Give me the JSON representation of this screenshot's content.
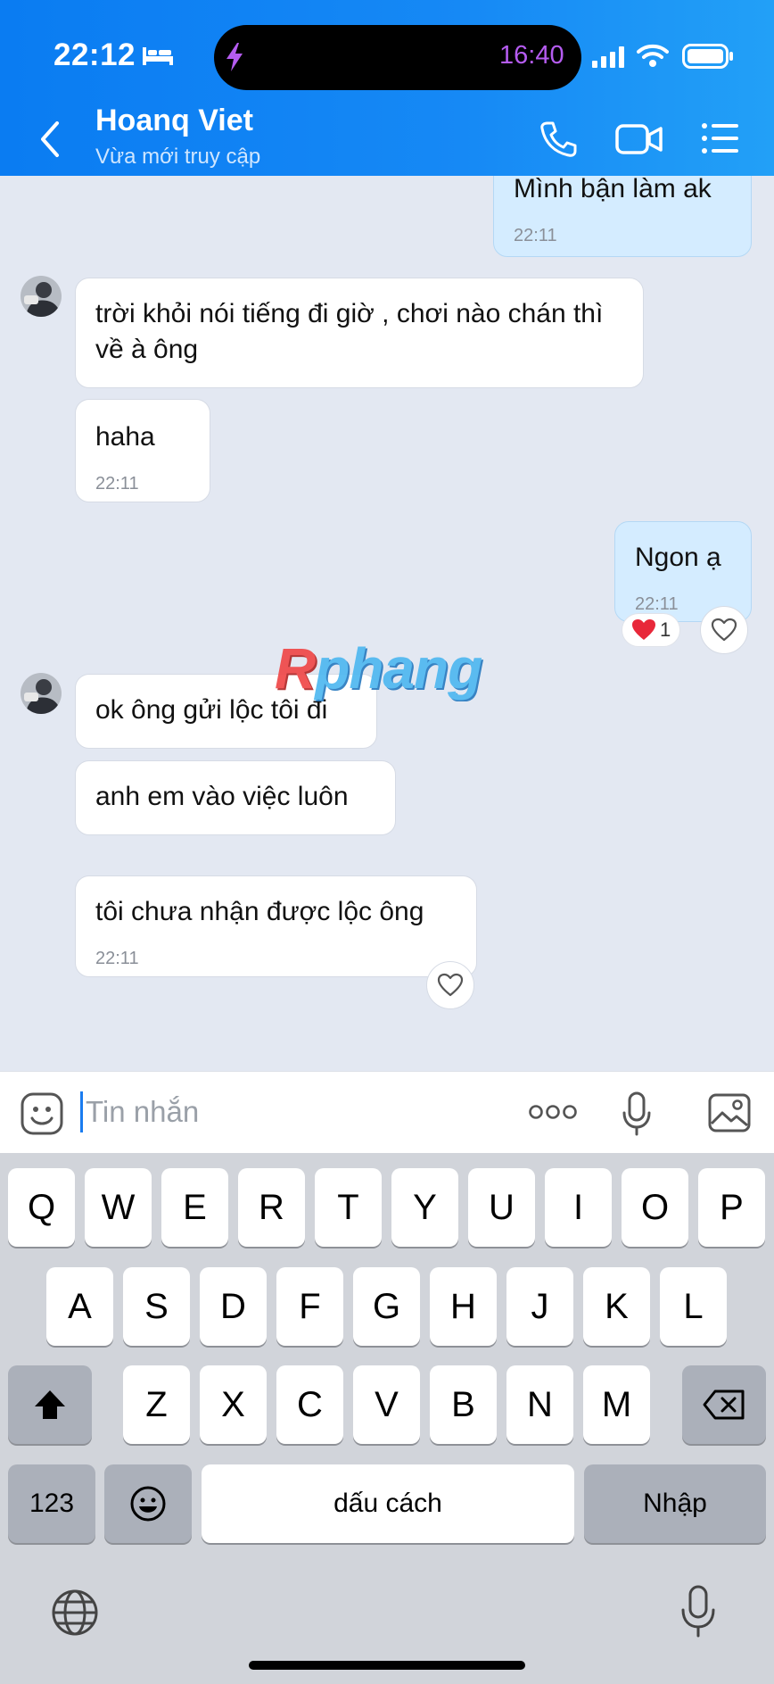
{
  "status_bar": {
    "time": "22:12",
    "activity_time": "16:40",
    "icons": [
      "bed-icon",
      "bolt-icon",
      "signal-icon",
      "wifi-icon",
      "battery-icon"
    ]
  },
  "header": {
    "contact_name": "Hoanq Viet",
    "contact_status": "Vừa mới truy cập",
    "icons": [
      "back-icon",
      "call-icon",
      "video-call-icon",
      "menu-icon"
    ],
    "accent_color": "#1689f5"
  },
  "messages": [
    {
      "side": "out",
      "text": "Mình bận làm ak",
      "time": "22:11"
    },
    {
      "side": "in",
      "text": "trời khỏi nói tiếng đi giờ , chơi nào chán thì về à ông",
      "time": ""
    },
    {
      "side": "in",
      "text": "haha",
      "time": "22:11"
    },
    {
      "side": "out",
      "text": "Ngon ạ",
      "time": "22:11",
      "reaction_count": "1"
    },
    {
      "side": "in",
      "text": "ok ông gửi lộc tôi đi",
      "time": ""
    },
    {
      "side": "in",
      "text": "anh em vào việc luôn",
      "time": ""
    },
    {
      "side": "in",
      "text": "tôi chưa nhận được lộc ông",
      "time": "22:11"
    }
  ],
  "watermark": {
    "first": "R",
    "rest": "phang"
  },
  "composer": {
    "placeholder": "Tin nhắn",
    "icons": [
      "sticker-icon",
      "more-icon",
      "mic-icon",
      "image-icon"
    ]
  },
  "keyboard": {
    "row1": [
      "Q",
      "W",
      "E",
      "R",
      "T",
      "Y",
      "U",
      "I",
      "O",
      "P"
    ],
    "row2": [
      "A",
      "S",
      "D",
      "F",
      "G",
      "H",
      "J",
      "K",
      "L"
    ],
    "row3": [
      "Z",
      "X",
      "C",
      "V",
      "B",
      "N",
      "M"
    ],
    "numbers_label": "123",
    "space_label": "dấu cách",
    "return_label": "Nhập"
  }
}
